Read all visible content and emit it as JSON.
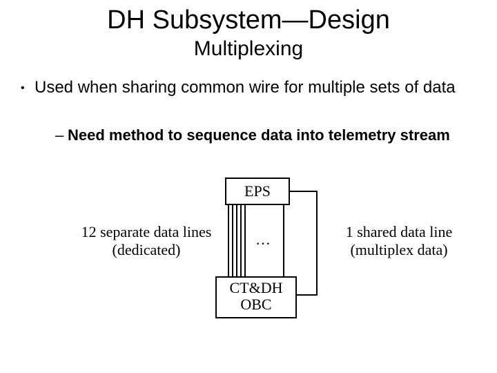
{
  "title": "DH Subsystem—Design",
  "subtitle": "Multiplexing",
  "bullet1": "Used when sharing common wire for multiple sets of data",
  "bullet2": "Need method to sequence data into telemetry stream",
  "diagram": {
    "eps": "EPS",
    "obc_line1": "CT&DH",
    "obc_line2": "OBC",
    "left_label_line1": "12 separate data lines",
    "left_label_line2": "(dedicated)",
    "right_label_line1": "1 shared data line",
    "right_label_line2": "(multiplex data)",
    "ellipsis": "…"
  }
}
